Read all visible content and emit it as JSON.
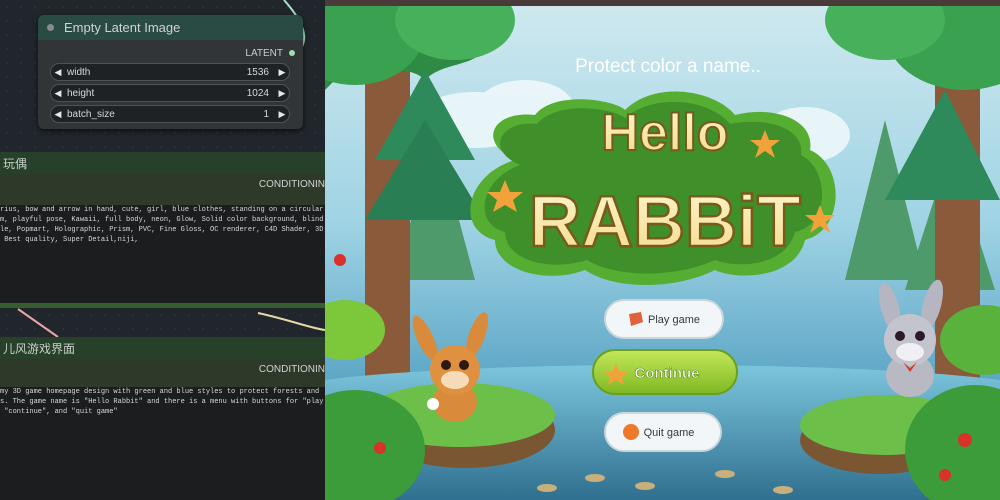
{
  "latent_node": {
    "title": "Empty Latent Image",
    "output_label": "LATENT",
    "widgets": [
      {
        "label": "width",
        "value": "1536"
      },
      {
        "label": "height",
        "value": "1024"
      },
      {
        "label": "batch_size",
        "value": "1"
      }
    ]
  },
  "prompt_1": {
    "title": "玩偶",
    "output_label": "CONDITIONIN",
    "text": [
      "rius, bow and arrow in hand, cute, girl, blue clothes, standing on a circular",
      "m, playful pose, Kawaii, full body, neon, Glow, Solid color background, blind",
      "le, Popmart, Holographic, Prism, PVC, Fine Gloss, OC renderer, C4D Shader, 3D",
      " Best quality, Super Detail,niji,"
    ]
  },
  "prompt_2": {
    "title": "儿风游戏界面",
    "output_label": "CONDITIONIN",
    "text": [
      "my 3D game homepage design with green and blue styles to protect forests and",
      "s. The game name is \"Hello Rabbit\" and there is a menu with buttons for \"play",
      " \"continue\", and \"quit game\""
    ]
  },
  "game": {
    "subtitle": "Protect color a name..",
    "title_line1": "Hello",
    "title_line2": "RABBiT",
    "buttons": {
      "play": "Play game",
      "continue": "Continue",
      "quit": "Quit game"
    }
  },
  "colors": {
    "node_header": "#2a4a44",
    "panel_title": "#26402a",
    "title_cream": "#fff3c4",
    "title_green": "#4e9a2a",
    "continue_green": "#9bd036"
  }
}
